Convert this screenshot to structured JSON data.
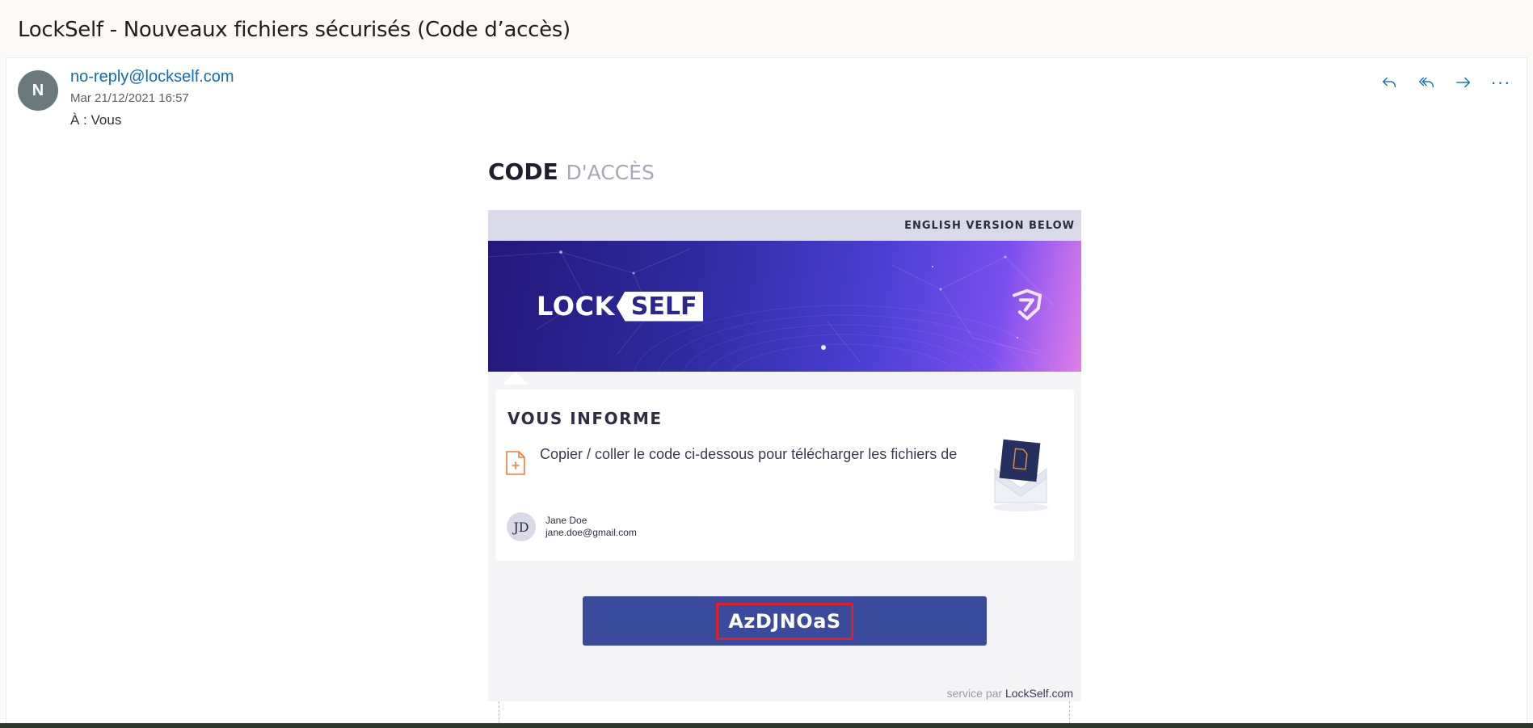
{
  "subject": "LockSelf - Nouveaux fichiers sécurisés (Code d’accès)",
  "sender": {
    "initial": "N",
    "email": "no-reply@lockself.com",
    "date": "Mar 21/12/2021 16:57",
    "to": "À :  Vous"
  },
  "actions": [
    {
      "name": "reply",
      "icon": "reply-icon"
    },
    {
      "name": "reply-all",
      "icon": "reply-all-icon"
    },
    {
      "name": "forward",
      "icon": "forward-icon"
    },
    {
      "name": "more",
      "icon": "more-icon",
      "label": "···"
    }
  ],
  "email": {
    "heading_bold": "CODE",
    "heading_light": "D'ACCÈS",
    "english_note": "ENGLISH VERSION BELOW",
    "logo_lock": "LOCK",
    "logo_self": "SELF",
    "informe_title": "VOUS INFORME",
    "message": "Copier / coller le code ci-dessous pour télécharger les fichiers de",
    "user_initials": "JD",
    "user_name": "Jane Doe",
    "user_email": "jane.doe@gmail.com",
    "access_code": "AzDJNOaS",
    "service_prefix": "service par",
    "service_brand": "LockSelf.com"
  },
  "colors": {
    "link": "#0f6cbd",
    "code_button": "#3a4a9d",
    "highlight_border": "#e0202a"
  }
}
